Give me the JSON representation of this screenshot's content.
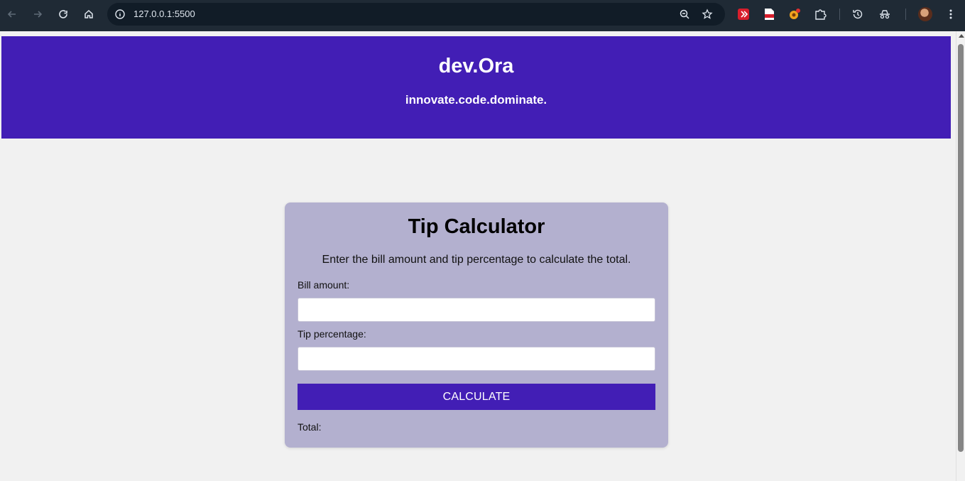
{
  "browser": {
    "url": "127.0.0.1:5500"
  },
  "header": {
    "brand": "dev.Ora",
    "tagline": "innovate.code.dominate.",
    "background": "#421eb5"
  },
  "calculator": {
    "title": "Tip Calculator",
    "description": "Enter the bill amount and tip percentage to calculate the total.",
    "bill_label": "Bill amount:",
    "bill_value": "",
    "tip_label": "Tip percentage:",
    "tip_value": "",
    "button_label": "CALCULATE",
    "total_label": "Total:",
    "card_color": "#b3b0cf",
    "accent_color": "#421eb5"
  }
}
